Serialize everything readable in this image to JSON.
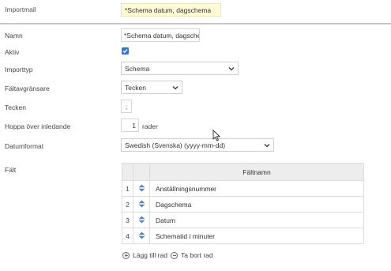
{
  "import_template": {
    "label": "Importmall",
    "value": "*Schema datum, dagschema"
  },
  "fields": {
    "name": {
      "label": "Namn",
      "value": "*Schema datum, dagschema"
    },
    "active": {
      "label": "Aktiv",
      "checked": true
    },
    "import_type": {
      "label": "Importtyp",
      "selected": "Schema"
    },
    "separator": {
      "label": "Fältavgränsare",
      "selected": "Tecken"
    },
    "character": {
      "label": "Tecken",
      "value": ";"
    },
    "skip_header": {
      "label": "Hoppa över inledande",
      "value": "1",
      "unit": "rader"
    },
    "date_format": {
      "label": "Datumformat",
      "selected": "Swedish (Svenska) (yyyy-mm-dd)"
    }
  },
  "field_table": {
    "label": "Fält",
    "header": "Fältnamn",
    "rows": [
      {
        "num": "1",
        "name": "Anställningsnummer"
      },
      {
        "num": "2",
        "name": "Dagschema"
      },
      {
        "num": "3",
        "name": "Datum"
      },
      {
        "num": "4",
        "name": "Schematid i minuter"
      }
    ]
  },
  "actions": {
    "add_row": "Lägg till rad",
    "remove_row": "Ta bort rad"
  },
  "colors": {
    "accent": "#3a76c4",
    "highlight": "#fffbd8"
  },
  "icons": {
    "drag": "drag-handle-icon",
    "chevron": "chevron-down-icon",
    "add": "plus-circle-icon",
    "remove": "minus-circle-icon",
    "check": "check-icon"
  }
}
